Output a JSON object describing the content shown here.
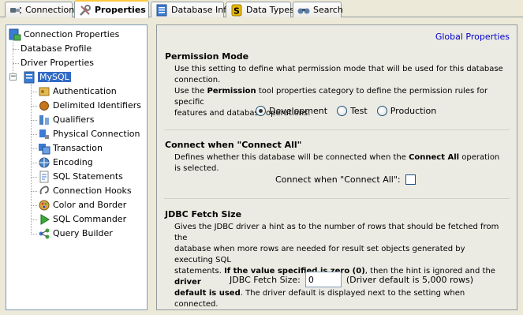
{
  "tabs": [
    {
      "label": "Connection",
      "icon": "plug-icon",
      "active": false
    },
    {
      "label": "Properties",
      "icon": "tools-icon",
      "active": true
    },
    {
      "label": "Database Info",
      "icon": "database-info-icon",
      "active": false
    },
    {
      "label": "Data Types",
      "icon": "data-types-icon",
      "active": false
    },
    {
      "label": "Search",
      "icon": "binoculars-icon",
      "active": false
    }
  ],
  "tree": {
    "root": "Connection Properties",
    "items": [
      {
        "label": "Database Profile"
      },
      {
        "label": "Driver Properties"
      },
      {
        "label": "MySQL",
        "selected": true,
        "expanded": true
      }
    ],
    "mysql_children": [
      {
        "label": "Authentication",
        "icon": "authentication-icon"
      },
      {
        "label": "Delimited Identifiers",
        "icon": "delimited-identifiers-icon"
      },
      {
        "label": "Qualifiers",
        "icon": "qualifiers-icon"
      },
      {
        "label": "Physical Connection",
        "icon": "physical-connection-icon"
      },
      {
        "label": "Transaction",
        "icon": "transaction-icon"
      },
      {
        "label": "Encoding",
        "icon": "encoding-icon"
      },
      {
        "label": "SQL Statements",
        "icon": "sql-statements-icon"
      },
      {
        "label": "Connection Hooks",
        "icon": "connection-hooks-icon"
      },
      {
        "label": "Color and Border",
        "icon": "color-border-icon"
      },
      {
        "label": "SQL Commander",
        "icon": "sql-commander-icon"
      },
      {
        "label": "Query Builder",
        "icon": "query-builder-icon"
      }
    ]
  },
  "content": {
    "global_link": "Global Properties",
    "permission": {
      "title": "Permission Mode",
      "desc_1": "Use this setting to define what permission mode that will be used for this database connection.",
      "desc_2a": "Use the ",
      "desc_2b": "Permission",
      "desc_2c": " tool properties category to define the permission rules for specific",
      "desc_3": "features and database operations.",
      "options": [
        "Development",
        "Test",
        "Production"
      ],
      "selected": "Development"
    },
    "connect_all": {
      "title": "Connect when \"Connect All\"",
      "desc_a": "Defines whether this database will be connected when the ",
      "desc_b": "Connect All",
      "desc_c": " operation is selected.",
      "label": "Connect when \"Connect All\":",
      "checked": false
    },
    "fetch": {
      "title": "JDBC Fetch Size",
      "desc_1": "Gives the JDBC driver a hint as to the number of rows that should be fetched from the",
      "desc_2": "database when more rows are needed for result set objects generated by executing SQL",
      "desc_3a": "statements. ",
      "desc_3b": "If the value specified is zero (0)",
      "desc_3c": ", then the hint is ignored and the ",
      "desc_3d": "driver",
      "desc_4a": "default is used",
      "desc_4b": ". The driver default is displayed next to the setting when connected.",
      "label": "JDBC Fetch Size:",
      "value": "0",
      "default_note": "(Driver default is 5,000 rows)"
    }
  },
  "colors": {
    "selection": "#316ac5",
    "link": "#0000cc",
    "tab_highlight": "#ffc83c"
  }
}
